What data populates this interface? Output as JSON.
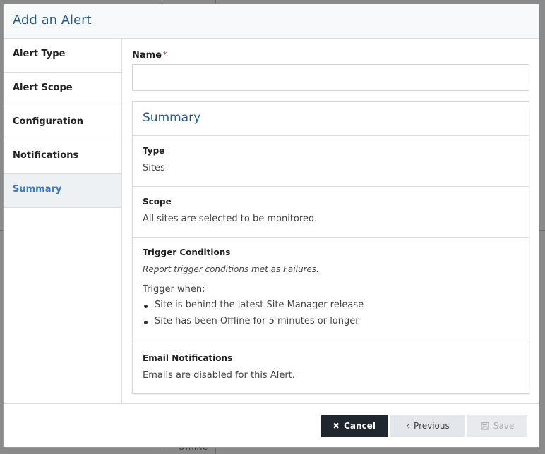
{
  "dialog": {
    "title": "Add an Alert"
  },
  "sidebar": {
    "items": [
      {
        "label": "Alert Type"
      },
      {
        "label": "Alert Scope"
      },
      {
        "label": "Configuration"
      },
      {
        "label": "Notifications"
      },
      {
        "label": "Summary",
        "active": true
      }
    ]
  },
  "form": {
    "name_label": "Name",
    "required_mark": "*",
    "name_value": "",
    "name_placeholder": ""
  },
  "summary": {
    "heading": "Summary",
    "type": {
      "title": "Type",
      "value": "Sites"
    },
    "scope": {
      "title": "Scope",
      "value": "All sites are selected to be monitored."
    },
    "trigger": {
      "title": "Trigger Conditions",
      "note": "Report trigger conditions met as Failures.",
      "when_label": "Trigger when:",
      "conditions": [
        "Site is behind the latest Site Manager release",
        "Site has been Offline for 5 minutes or longer"
      ]
    },
    "email": {
      "title": "Email Notifications",
      "value": "Emails are disabled for this Alert."
    }
  },
  "footer": {
    "cancel_label": "Cancel",
    "previous_label": "Previous",
    "save_label": "Save"
  },
  "colors": {
    "accent": "#2a5a8a",
    "active_nav": "#3a78b8",
    "required": "#c0392b",
    "cancel_bg": "#1f262d"
  },
  "background": {
    "partial_text": "Offline"
  }
}
